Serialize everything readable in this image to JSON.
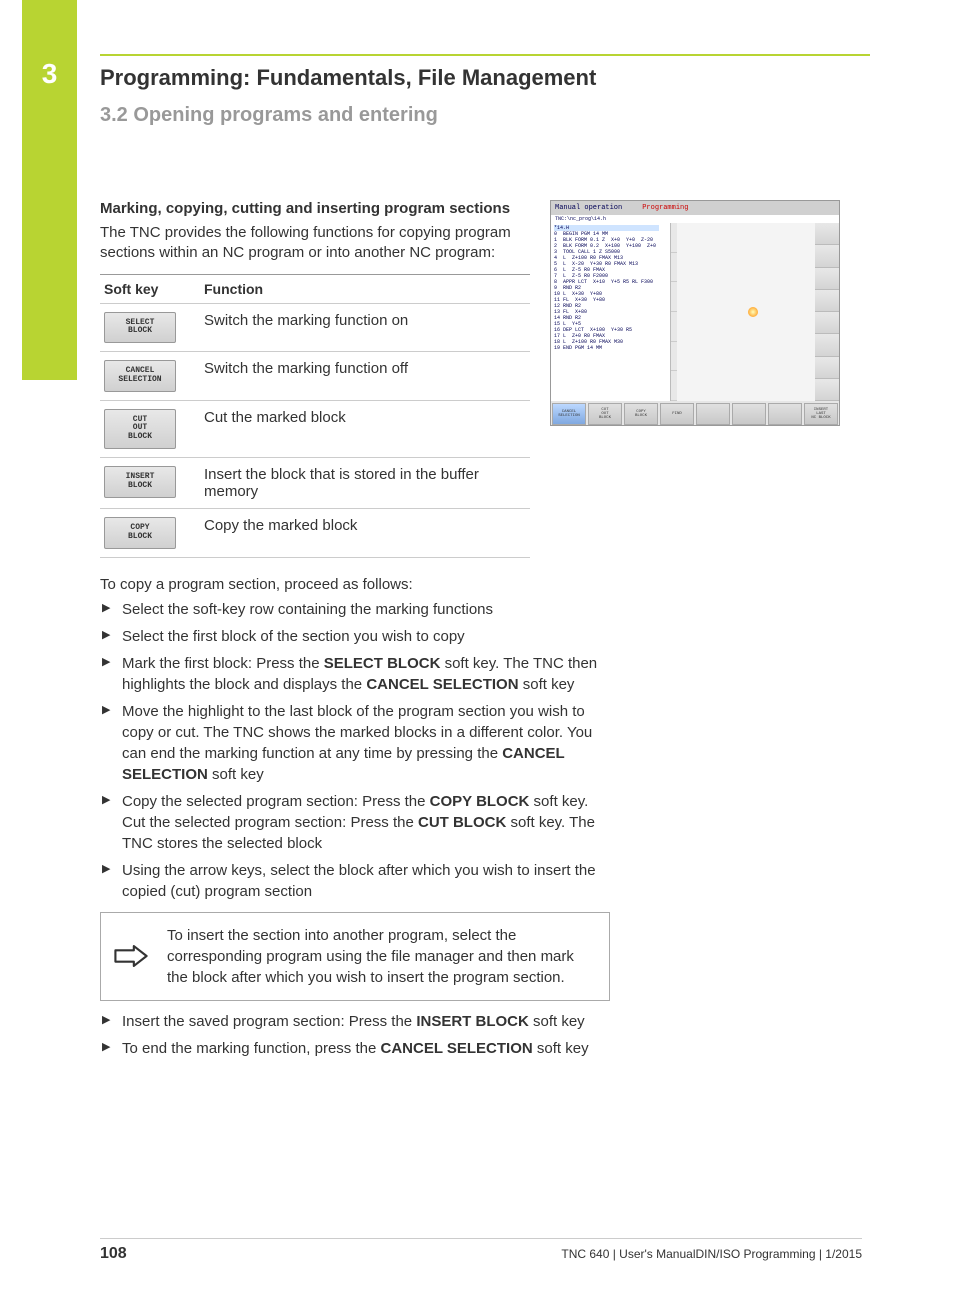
{
  "chapterNumber": "3",
  "chapterTitle": "Programming: Fundamentals, File Management",
  "sectionTitle": "3.2    Opening programs and entering",
  "subhead": "Marking, copying, cutting and inserting program sections",
  "introText": "The TNC provides the following functions for copying program sections within an NC program or into another NC program:",
  "table": {
    "header1": "Soft key",
    "header2": "Function",
    "rows": [
      {
        "key": "SELECT\nBLOCK",
        "func": "Switch the marking function on"
      },
      {
        "key": "CANCEL\nSELECTION",
        "func": "Switch the marking function off"
      },
      {
        "key": "CUT\nOUT\nBLOCK",
        "func": "Cut the marked block"
      },
      {
        "key": "INSERT\nBLOCK",
        "func": "Insert the block that is stored in the buffer memory"
      },
      {
        "key": "COPY\nBLOCK",
        "func": "Copy the marked block"
      }
    ]
  },
  "stepsIntro": "To copy a program section, proceed as follows:",
  "steps1": [
    {
      "text": "Select the soft-key row containing the marking functions"
    },
    {
      "text": "Select the first block of the section you wish to copy"
    },
    {
      "prefix": "Mark the first block: Press the ",
      "b1": "SELECT BLOCK",
      "mid": " soft key. The TNC then highlights the block and displays the ",
      "b2": "CANCEL SELECTION",
      "suffix": " soft key"
    },
    {
      "prefix": "Move the highlight to the last block of the program section you wish to copy or cut. The TNC shows the marked blocks in a different color. You can end the marking function at any time by pressing the ",
      "b1": "CANCEL SELECTION",
      "suffix": " soft key"
    },
    {
      "prefix": "Copy the selected program section: Press the ",
      "b1": "COPY BLOCK",
      "mid": " soft key. Cut the selected program section: Press the ",
      "b2": "CUT BLOCK",
      "suffix": " soft key. The TNC stores the selected block"
    },
    {
      "text": "Using the arrow keys, select the block after which you wish to insert the copied (cut) program section"
    }
  ],
  "noteText": "To insert the section into another program, select the corresponding program using the file manager and then mark the block after which you wish to insert the program section.",
  "steps2": [
    {
      "prefix": "Insert the saved program section: Press the ",
      "b1": "INSERT BLOCK",
      "suffix": " soft key"
    },
    {
      "prefix": "To end the marking function, press the ",
      "b1": "CANCEL SELECTION",
      "suffix": " soft key"
    }
  ],
  "footer": {
    "pageNum": "108",
    "text": "TNC 640 | User's ManualDIN/ISO Programming | 1/2015"
  },
  "screenshot": {
    "mode1": "Manual operation",
    "mode2": "Programming",
    "mode2sub": "→ Programming",
    "topPath": "TNC:\\nc_prog\\14.h",
    "hlLine": "*14.H",
    "code": "0  BEGIN PGM 14 MM\n1  BLK FORM 0.1 Z  X+0  Y+0  Z-20\n2  BLK FORM 0.2  X+100  Y+100  Z+0\n3  TOOL CALL 1 Z S5000\n4  L  Z+100 R0 FMAX M13\n5  L  X-20  Y+30 R0 FMAX M13\n6  L  Z-5 R0 FMAX\n7  L  Z-5 R0 F2000\n8  APPR LCT  X+10  Y+5 R5 RL F300\n9  RND R2\n10 L  X+30  Y+80\n11 FL  X+30  Y+80\n12 RND R2\n13 FL  X+80\n14 RND R2\n15 L  Y+5\n16 DEP LCT  X+100  Y+30 R5\n17 L  Z+0 R0 FMAX\n18 L  Z+100 R0 FMAX M30\n19 END PGM 14 MM",
    "softkeys": [
      "CANCEL\nSELECTION",
      "CUT\nOUT\nBLOCK",
      "COPY\nBLOCK",
      "FIND",
      "",
      "",
      "",
      "INSERT\nLAST\nNC BLOCK"
    ]
  }
}
